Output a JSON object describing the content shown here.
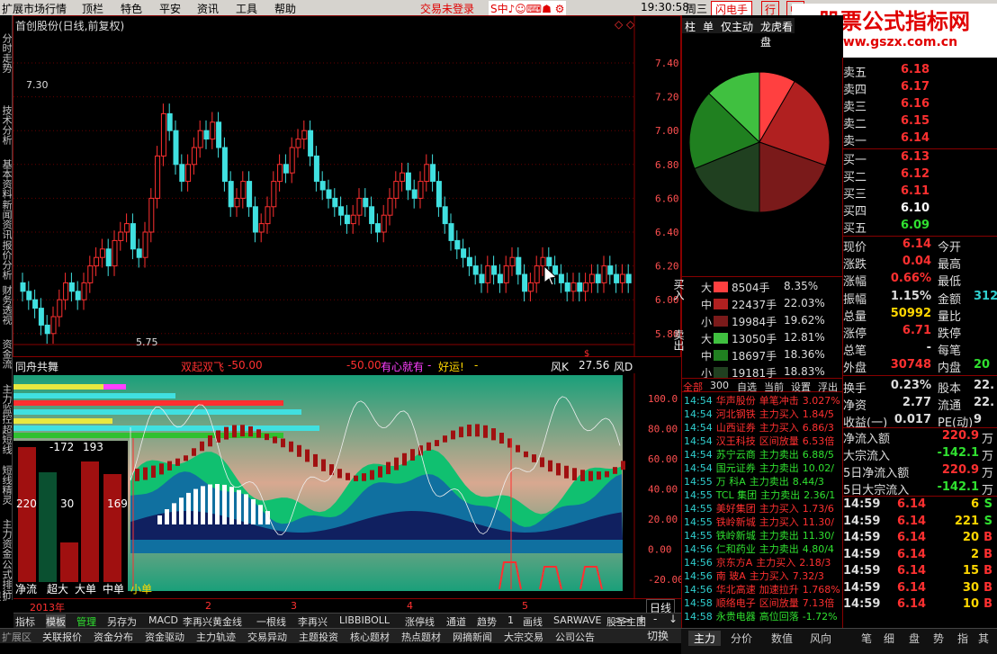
{
  "menu": {
    "items": [
      "扩展市场行情",
      "顶栏",
      "特色",
      "平安",
      "资讯",
      "工具",
      "帮助"
    ],
    "trade_status": "交易未登录",
    "time": "19:30:58",
    "weekday": "周三",
    "flash_btn": "闪电手",
    "ext1": "行",
    "ext2": "中"
  },
  "watermark": {
    "title": "股票公式指标网",
    "url": "www.gszx.com.cn"
  },
  "left_tabs": [
    "分时走势",
    "技术分析",
    "基本资料",
    "新闻资讯",
    "报价分析",
    "财务透视",
    "资金流",
    "主力监控",
    "超短线",
    "短线精灵",
    "主力资金",
    "公式排行",
    "扩展"
  ],
  "chart": {
    "title": "首创股份(日线,前复权)",
    "price_labels": [
      "7.40",
      "7.20",
      "7.00",
      "6.80",
      "6.60",
      "6.40",
      "6.20",
      "6.00",
      "5.80"
    ],
    "high_mark": "7.30",
    "low_mark": "5.75"
  },
  "indicator": {
    "name": "同舟共舞",
    "line1_label": "双起双飞",
    "line1_val": "-50.00",
    "line2_val": "-50.00",
    "line3_label": "有心就有",
    "line3_val": "-",
    "line4_label": "好运!",
    "line4_val": "-",
    "wind_label": "风K",
    "wind_val": "27.56",
    "wind_d_label": "风D",
    "axis": [
      "100.0",
      "80.00",
      "60.00",
      "40.00",
      "20.00",
      "0.00",
      "-20.00"
    ]
  },
  "flow_box": {
    "values": [
      "-172",
      "193",
      "220",
      "30",
      "169"
    ],
    "labels": [
      "净流",
      "超大",
      "大单",
      "中单",
      "小单"
    ]
  },
  "timeline": {
    "labels": [
      "2013年",
      "2",
      "3",
      "4",
      "5"
    ],
    "period": "日线"
  },
  "bottom_tabs": [
    "指标",
    "模板",
    "管理",
    "另存为",
    "MACD",
    "李再兴黄金线",
    "一根线",
    "李再兴",
    "LIBBIBOLL",
    "涨停线",
    "通道",
    "趋势",
    "1",
    "画线",
    "SARWAVE",
    "股圣主图"
  ],
  "bottom_tabs2": [
    "扩展区",
    "关联报价",
    "资金分布",
    "资金驱动",
    "主力轨迹",
    "交易异动",
    "主题投资",
    "核心题材",
    "热点题材",
    "网摘新闻",
    "大宗交易",
    "公司公告"
  ],
  "right_tabs": [
    "柱",
    "单",
    "仅主动",
    "龙虎看盘"
  ],
  "orders": {
    "sell": [
      {
        "label": "卖五",
        "price": "6.18"
      },
      {
        "label": "卖四",
        "price": "6.17"
      },
      {
        "label": "卖三",
        "price": "6.16"
      },
      {
        "label": "卖二",
        "price": "6.15"
      },
      {
        "label": "卖一",
        "price": "6.14"
      }
    ],
    "buy": [
      {
        "label": "买一",
        "price": "6.13"
      },
      {
        "label": "买二",
        "price": "6.12"
      },
      {
        "label": "买三",
        "price": "6.11"
      },
      {
        "label": "买四",
        "price": "6.10"
      },
      {
        "label": "买五",
        "price": "6.09"
      }
    ]
  },
  "stats": [
    {
      "l": "现价",
      "v": "6.14",
      "l2": "今开"
    },
    {
      "l": "涨跌",
      "v": "0.04",
      "l2": "最高"
    },
    {
      "l": "涨幅",
      "v": "0.66%",
      "l2": "最低"
    },
    {
      "l": "振幅",
      "v": "1.15%",
      "l2": "金额",
      "v2": "312"
    },
    {
      "l": "总量",
      "v": "50992",
      "l2": "量比"
    },
    {
      "l": "涨停",
      "v": "6.71",
      "l2": "跌停"
    },
    {
      "l": "总笔",
      "v": "-",
      "l2": "每笔"
    },
    {
      "l": "外盘",
      "v": "30748",
      "l2": "内盘",
      "v2": "20"
    },
    {
      "l": "换手",
      "v": "0.23%",
      "l2": "股本",
      "v2": "22."
    },
    {
      "l": "净资",
      "v": "2.77",
      "l2": "流通",
      "v2": "22."
    },
    {
      "l": "收益(一)",
      "v": "0.017",
      "l2": "PE(动)",
      "v2": "9"
    }
  ],
  "flows": [
    {
      "l": "净流入额",
      "v": "220.9",
      "u": "万"
    },
    {
      "l": "大宗流入",
      "v": "-142.1",
      "u": "万"
    },
    {
      "l": "5日净流入额",
      "v": "220.9",
      "u": "万"
    },
    {
      "l": "5日大宗流入",
      "v": "-142.1",
      "u": "万"
    }
  ],
  "ticks": [
    {
      "t": "14:59",
      "p": "6.14",
      "v": "6",
      "s": "S"
    },
    {
      "t": "14:59",
      "p": "6.14",
      "v": "221",
      "s": "S"
    },
    {
      "t": "14:59",
      "p": "6.14",
      "v": "20",
      "s": "B"
    },
    {
      "t": "14:59",
      "p": "6.14",
      "v": "2",
      "s": "B"
    },
    {
      "t": "14:59",
      "p": "6.14",
      "v": "15",
      "s": "B"
    },
    {
      "t": "14:59",
      "p": "6.14",
      "v": "30",
      "s": "B"
    },
    {
      "t": "14:59",
      "p": "6.14",
      "v": "10",
      "s": "B"
    }
  ],
  "volume_split": {
    "buy": [
      {
        "l": "大",
        "v": "8504手",
        "p": "8.35%"
      },
      {
        "l": "中",
        "v": "22437手",
        "p": "22.03%"
      },
      {
        "l": "小",
        "v": "19984手",
        "p": "19.62%"
      }
    ],
    "sell": [
      {
        "l": "大",
        "v": "13050手",
        "p": "12.81%"
      },
      {
        "l": "中",
        "v": "18697手",
        "p": "18.36%"
      },
      {
        "l": "小",
        "v": "19181手",
        "p": "18.83%"
      }
    ],
    "buy_label": "买入",
    "sell_label": "卖出"
  },
  "market_tabs": [
    "全部",
    "300",
    "自选",
    "当前",
    "设置",
    "浮出",
    "扩"
  ],
  "trades": [
    {
      "t": "14:54",
      "n": "华声股份",
      "a": "单笔冲击",
      "v": "3.027%"
    },
    {
      "t": "14:54",
      "n": "河北钢铁",
      "a": "主力买入",
      "v": "1.84/5"
    },
    {
      "t": "14:54",
      "n": "山西证券",
      "a": "主力买入",
      "v": "6.86/3"
    },
    {
      "t": "14:54",
      "n": "汉王科技",
      "a": "区间放量",
      "v": "6.53倍"
    },
    {
      "t": "14:54",
      "n": "苏宁云商",
      "a": "主力卖出",
      "v": "6.88/5"
    },
    {
      "t": "14:54",
      "n": "国元证券",
      "a": "主力卖出",
      "v": "10.02/"
    },
    {
      "t": "14:55",
      "n": "万 科A",
      "a": "主力卖出",
      "v": "8.44/3"
    },
    {
      "t": "14:55",
      "n": "TCL 集团",
      "a": "主力卖出",
      "v": "2.36/1"
    },
    {
      "t": "14:55",
      "n": "美好集团",
      "a": "主力买入",
      "v": "1.73/6"
    },
    {
      "t": "14:55",
      "n": "铁岭新城",
      "a": "主力买入",
      "v": "11.30/"
    },
    {
      "t": "14:55",
      "n": "铁岭新城",
      "a": "主力卖出",
      "v": "11.30/"
    },
    {
      "t": "14:56",
      "n": "仁和药业",
      "a": "主力卖出",
      "v": "4.80/4"
    },
    {
      "t": "14:56",
      "n": "京东方A",
      "a": "主力买入",
      "v": "2.18/3"
    },
    {
      "t": "14:56",
      "n": "南 玻A",
      "a": "主力买入",
      "v": "7.32/3"
    },
    {
      "t": "14:56",
      "n": "华北高速",
      "a": "加速拉升",
      "v": "1.768%"
    },
    {
      "t": "14:58",
      "n": "顺络电子",
      "a": "区间放量",
      "v": "7.13倍"
    },
    {
      "t": "14:58",
      "n": "永贵电器",
      "a": "高位回落",
      "v": "-1.72%"
    }
  ],
  "right_bottom_tabs": [
    "主力",
    "分价",
    "数值",
    "风向",
    "笔",
    "细",
    "盘",
    "势",
    "指",
    "其"
  ],
  "mid_bottom": [
    "+",
    "-",
    "↓"
  ],
  "switch_label": "切换"
}
